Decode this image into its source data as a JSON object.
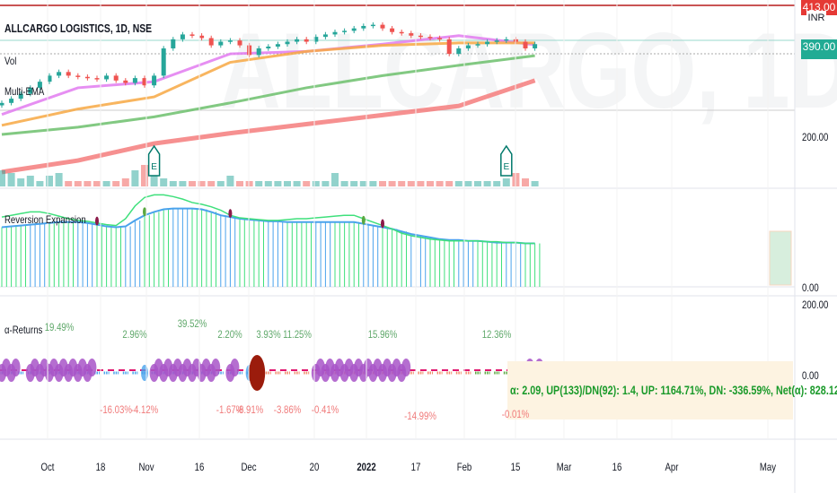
{
  "header": {
    "symbol_title": "ALLCARGO LOGISTICS, 1D, NSE",
    "watermark": "ALLCARGO, 1D"
  },
  "indicators": {
    "volume": "Vol",
    "multi_ema": "Multi-EMA",
    "reversion": "Reversion Expansion",
    "returns": "α-Returns"
  },
  "price_axis": {
    "currency": "INR",
    "high_label": "413.00",
    "last_label": "390.00",
    "tick_200": "200.00",
    "rev_zero": "0.00",
    "rev_top": "200.00",
    "ret_zero": "0.00"
  },
  "colors": {
    "up": "#26a69a",
    "down": "#ef5350",
    "ema_fast": "#e27bf0",
    "ema_mid": "#f7a843",
    "ema_slow": "#6cbf6c",
    "ema_long": "#f47c7c",
    "purple": "#a855c8",
    "blue": "#4aa3ec",
    "green_line": "#3fe07c",
    "dash": "#e0146e",
    "summary_bg": "#fdf3e1"
  },
  "time_axis": [
    "Oct",
    "18",
    "Nov",
    "16",
    "Dec",
    "20",
    "2022",
    "17",
    "Feb",
    "15",
    "Mar",
    "16",
    "Apr",
    "May"
  ],
  "summary": {
    "text": "α: 2.09, UP(133)/DN(92): 1.4, UP: 1164.71%, DN: -336.59%, Net(α): 828.12%"
  },
  "chart_data": [
    {
      "type": "candlestick",
      "title": "ALLCARGO LOGISTICS, 1D, NSE",
      "closes": [
        255,
        262,
        270,
        280,
        290,
        300,
        306,
        300,
        298,
        296,
        294,
        300,
        292,
        288,
        296,
        284,
        300,
        345,
        360,
        368,
        366,
        362,
        350,
        356,
        358,
        350,
        334,
        345,
        348,
        352,
        356,
        360,
        356,
        364,
        368,
        372,
        374,
        378,
        382,
        384,
        378,
        372,
        370,
        366,
        364,
        362,
        360,
        336,
        345,
        350,
        352,
        356,
        358,
        360,
        356,
        345,
        352
      ],
      "ema_series": [
        {
          "values": [
            236,
            280,
            290,
            336,
            340,
            352,
            366,
            351
          ]
        },
        {
          "values": [
            218,
            245,
            265,
            322,
            340,
            350,
            354,
            354
          ]
        },
        {
          "values": [
            203,
            215,
            232,
            255,
            280,
            300,
            317,
            333
          ]
        },
        {
          "values": [
            141,
            160,
            188,
            205,
            220,
            235,
            250,
            292
          ]
        }
      ],
      "volume": [
        6,
        5,
        3,
        4,
        2,
        4,
        5,
        2,
        2,
        2,
        2,
        2,
        2,
        3,
        6,
        8,
        4,
        3,
        2,
        2,
        2,
        2,
        2,
        2,
        4,
        2,
        2,
        2,
        2,
        2,
        2,
        2,
        2,
        2,
        2,
        5,
        2,
        2,
        2,
        2,
        2,
        2,
        2,
        2,
        2,
        2,
        2,
        2,
        2,
        2,
        2,
        2,
        2,
        3,
        5,
        3,
        2
      ],
      "earnings_markers": [
        16,
        53
      ],
      "ylim": [
        100,
        420
      ]
    },
    {
      "type": "histogram+line",
      "title": "Reversion Expansion",
      "band": [
        70,
        71,
        72,
        73,
        74,
        75,
        76,
        76,
        76,
        75,
        73,
        71,
        70,
        71,
        78,
        84,
        88,
        91,
        92,
        92,
        92,
        91,
        88,
        84,
        82,
        80,
        79,
        78,
        77,
        77,
        76,
        76,
        76,
        76,
        76,
        76,
        76,
        76,
        74,
        72,
        70,
        68,
        65,
        62,
        60,
        58,
        56,
        55,
        55,
        54,
        54,
        53,
        52,
        52,
        52,
        51,
        51
      ],
      "signal": [
        82,
        84,
        86,
        88,
        88,
        86,
        83,
        80,
        78,
        77,
        75,
        73,
        72,
        80,
        95,
        105,
        108,
        108,
        106,
        103,
        99,
        97,
        94,
        90,
        84,
        81,
        80,
        79,
        78,
        78,
        79,
        80,
        80,
        81,
        82,
        83,
        84,
        84,
        80,
        76,
        72,
        68,
        63,
        60,
        58,
        56,
        55,
        54,
        54,
        54,
        54,
        53,
        53,
        52,
        52,
        51,
        51
      ]
    },
    {
      "type": "returns",
      "title": "α-Returns",
      "labels": [
        {
          "text": "19.49%",
          "idx": 6,
          "up": true
        },
        {
          "text": "2.96%",
          "idx": 14,
          "up": true
        },
        {
          "text": "39.52%",
          "idx": 20,
          "up": true
        },
        {
          "text": "2.20%",
          "idx": 24,
          "up": true
        },
        {
          "text": "3.93%",
          "idx": 28,
          "up": true
        },
        {
          "text": "11.25%",
          "idx": 31,
          "up": true
        },
        {
          "text": "15.96%",
          "idx": 40,
          "up": true
        },
        {
          "text": "12.36%",
          "idx": 52,
          "up": true
        },
        {
          "text": "-16.03%",
          "idx": 12,
          "up": false
        },
        {
          "text": "-4.12%",
          "idx": 15,
          "up": false
        },
        {
          "text": "-1.67%",
          "idx": 24,
          "up": false
        },
        {
          "text": "-8.91%",
          "idx": 26,
          "up": false
        },
        {
          "text": "-3.86%",
          "idx": 30,
          "up": false
        },
        {
          "text": "-0.41%",
          "idx": 34,
          "up": false
        },
        {
          "text": "-14.99%",
          "idx": 44,
          "up": false
        },
        {
          "text": "-0.01%",
          "idx": 54,
          "up": false
        }
      ],
      "signal_clusters": [
        [
          0,
          1
        ],
        [
          3,
          7
        ],
        [
          8,
          9
        ],
        [
          16,
          22
        ],
        [
          24,
          24
        ],
        [
          33,
          35
        ],
        [
          36,
          42
        ],
        [
          55,
          56
        ]
      ],
      "exit_markers": [
        15,
        26
      ],
      "big_marker": 27,
      "zero": 0
    }
  ]
}
